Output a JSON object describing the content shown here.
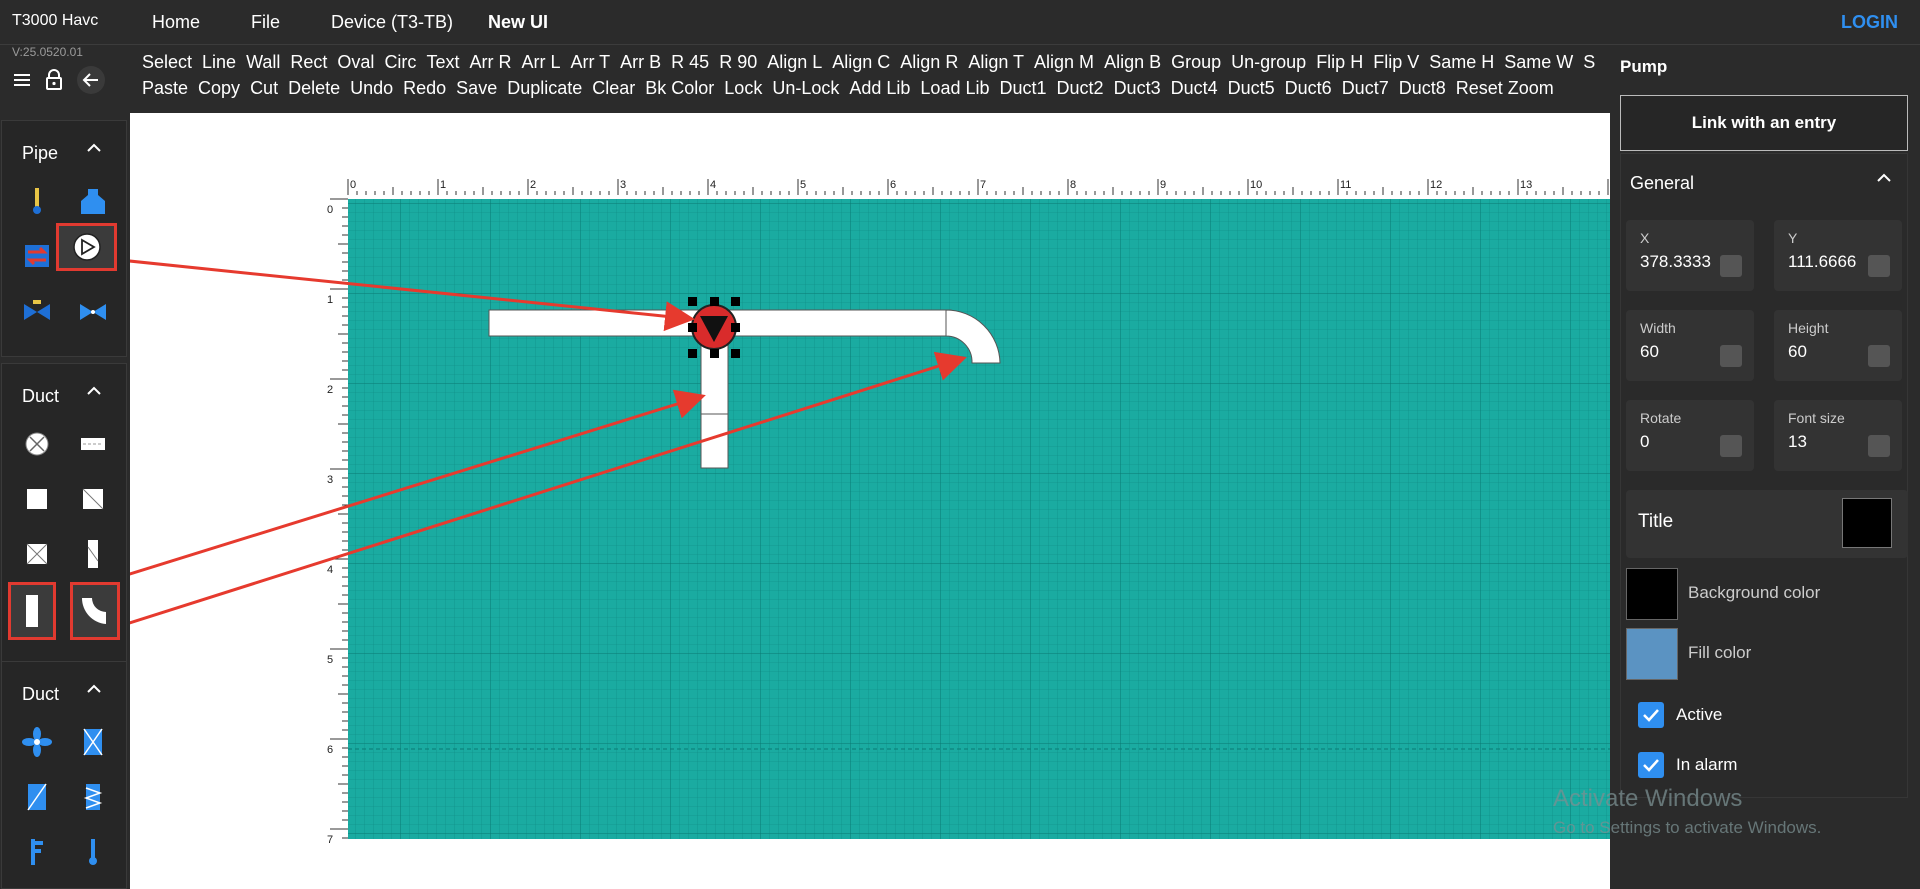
{
  "app": {
    "title": "T3000 Havc",
    "version": "V:25.0520.01"
  },
  "nav": {
    "items": [
      "Home",
      "File",
      "Device (T3-TB)",
      "New UI"
    ],
    "active": "New UI",
    "login": "LOGIN"
  },
  "toolbar": {
    "row1": [
      "Select",
      "Line",
      "Wall",
      "Rect",
      "Oval",
      "Circ",
      "Text",
      "Arr R",
      "Arr L",
      "Arr T",
      "Arr B",
      "R 45",
      "R 90",
      "Align L",
      "Align C",
      "Align R",
      "Align T",
      "Align M",
      "Align B",
      "Group",
      "Un-group",
      "Flip H",
      "Flip V",
      "Same H",
      "Same W",
      "S"
    ],
    "row2": [
      "Paste",
      "Copy",
      "Cut",
      "Delete",
      "Undo",
      "Redo",
      "Save",
      "Duplicate",
      "Clear",
      "Bk Color",
      "Lock",
      "Un-Lock",
      "Add Lib",
      "Load Lib",
      "Duct1",
      "Duct2",
      "Duct3",
      "Duct4",
      "Duct5",
      "Duct6",
      "Duct7",
      "Duct8",
      "Reset Zoom"
    ]
  },
  "library": {
    "panels": [
      {
        "title": "Pipe",
        "icons": [
          "thermometer-icon",
          "tank-icon",
          "heat-exchanger-icon",
          "pump-icon",
          "valve-icon",
          "butterfly-valve-icon"
        ],
        "selected": "pump-icon"
      },
      {
        "title": "Duct",
        "icons": [
          "round-damper-icon",
          "duct-divider-icon",
          "square-duct-icon",
          "square-damper-icon",
          "filter-icon",
          "thin-duct-icon",
          "straight-duct-icon",
          "elbow-duct-icon"
        ],
        "selected": [
          "straight-duct-icon",
          "elbow-duct-icon"
        ]
      },
      {
        "title": "Duct",
        "icons": [
          "fan-icon",
          "filter-box-icon",
          "coil-icon",
          "heater-icon",
          "flag-icon",
          "sensor-icon"
        ]
      }
    ]
  },
  "ruler": {
    "x_labels": [
      "0",
      "1",
      "2",
      "3",
      "4",
      "5",
      "6",
      "7",
      "8",
      "9",
      "10",
      "11",
      "12",
      "13"
    ],
    "y_labels": [
      "0",
      "1",
      "2",
      "3",
      "4",
      "5",
      "6",
      "7"
    ]
  },
  "canvas": {
    "grid_color": "#1aaba1",
    "pump_color": "#d92b2b",
    "annotation_color": "#e63a2e"
  },
  "properties": {
    "title": "Pump",
    "link_button": "Link with an entry",
    "section": "General",
    "fields": [
      {
        "label": "X",
        "value": "378.3333"
      },
      {
        "label": "Y",
        "value": "111.6666"
      },
      {
        "label": "Width",
        "value": "60"
      },
      {
        "label": "Height",
        "value": "60"
      },
      {
        "label": "Rotate",
        "value": "0"
      },
      {
        "label": "Font size",
        "value": "13"
      }
    ],
    "title_label": "Title",
    "title_color": "#000000",
    "background_label": "Background color",
    "background_color": "#000000",
    "fill_label": "Fill color",
    "fill_color": "#5b93c2",
    "active_label": "Active",
    "active_checked": true,
    "alarm_label": "In alarm",
    "alarm_checked": true
  },
  "watermark": {
    "line1": "Activate Windows",
    "line2": "Go to Settings to activate Windows."
  }
}
